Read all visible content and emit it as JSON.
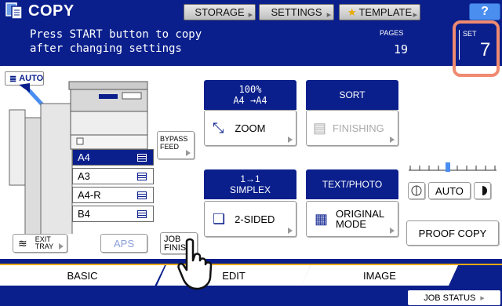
{
  "app": {
    "title": "COPY",
    "icon": "copy-icon"
  },
  "topbar": {
    "storage_label": "STORAGE",
    "settings_label": "SETTINGS",
    "template_label": "TEMPLATE",
    "help_label": "?"
  },
  "message": {
    "line1": "Press START button to copy",
    "line2": "after changing settings",
    "pages_label": "PAGES",
    "pages_value": "19",
    "set_label": "SET",
    "set_value": "7"
  },
  "paper": {
    "auto_label": "AUTO",
    "trays": [
      {
        "label": "A4",
        "selected": true
      },
      {
        "label": "A3",
        "selected": false
      },
      {
        "label": "A4-R",
        "selected": false
      },
      {
        "label": "B4",
        "selected": false
      }
    ],
    "bypass_line1": "BYPASS",
    "bypass_line2": "FEED",
    "exit_line1": "EXIT",
    "exit_line2": "TRAY",
    "aps_label": "APS",
    "job_finish_line1": "JOB",
    "job_finish_line2": "FINISH"
  },
  "functions": {
    "zoom_header_line1": "100%",
    "zoom_header_line2": "A4  →A4",
    "zoom_label": "ZOOM",
    "sort_header": "SORT",
    "finishing_label": "FINISHING",
    "duplex_header_line1": "1→1",
    "duplex_header_line2": "SIMPLEX",
    "duplex_label": "2-SIDED",
    "mode_header": "TEXT/PHOTO",
    "mode_label_line1": "ORIGINAL",
    "mode_label_line2": "MODE"
  },
  "density": {
    "auto_label": "AUTO",
    "level": 0.45
  },
  "proof_copy_label": "PROOF COPY",
  "tabs": {
    "basic": "BASIC",
    "edit": "EDIT",
    "image": "IMAGE"
  },
  "job_status_label": "JOB STATUS",
  "colors": {
    "header_blue": "#0a1f8c",
    "highlight": "#ef8a70"
  }
}
